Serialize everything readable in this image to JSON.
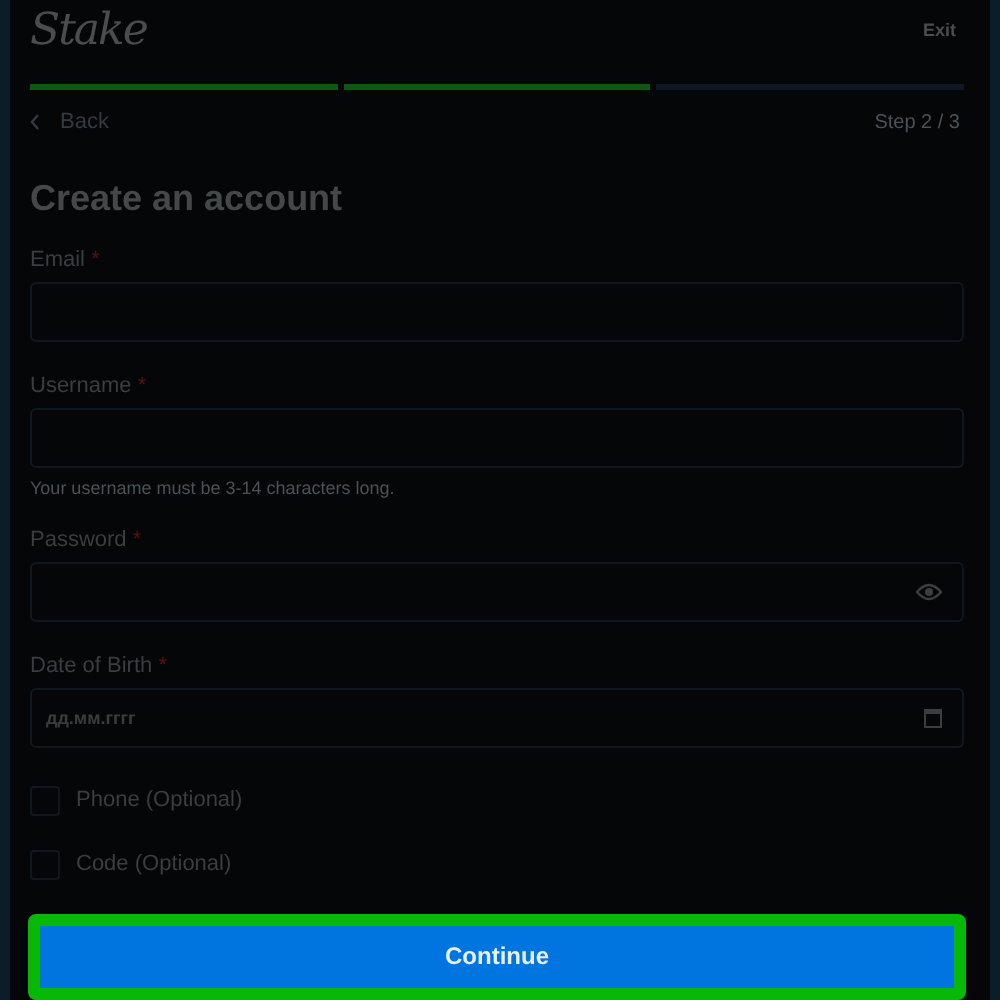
{
  "header": {
    "logo": "Stake",
    "exit": "Exit"
  },
  "progress": [
    {
      "completed": true
    },
    {
      "completed": true
    },
    {
      "completed": false
    }
  ],
  "nav": {
    "back": "Back",
    "step": "Step 2 / 3"
  },
  "title": "Create an account",
  "fields": [
    {
      "kind": "text",
      "label": "Email",
      "required": "*"
    },
    {
      "kind": "text",
      "label": "Username",
      "required": "*",
      "hint": "Your username must be 3-14 characters long."
    },
    {
      "kind": "password",
      "label": "Password",
      "required": "*"
    },
    {
      "kind": "date",
      "label": "Date of Birth",
      "required": "*",
      "placeholder": "дд.мм.гггг"
    }
  ],
  "options": [
    {
      "label": "Phone (Optional)",
      "checked": false
    },
    {
      "label": "Code (Optional)",
      "checked": false
    }
  ],
  "button": {
    "label": "Continue",
    "highlighted": true
  }
}
